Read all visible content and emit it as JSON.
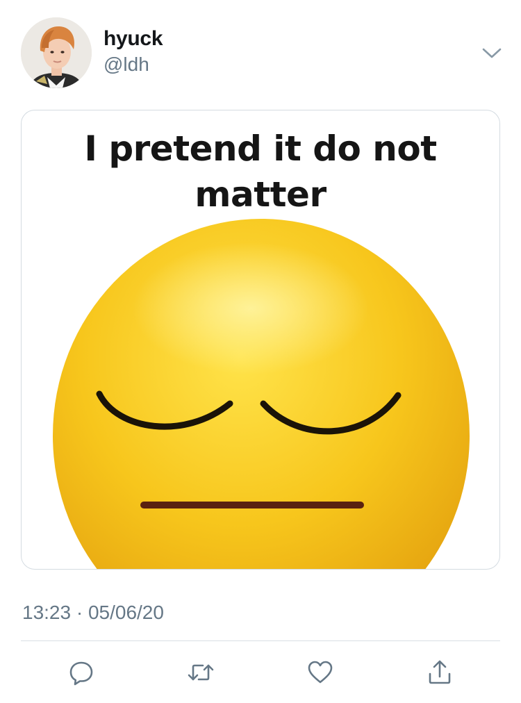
{
  "user": {
    "display_name": "hyuck",
    "handle": "@ldh",
    "avatar_icon": "profile-photo"
  },
  "tweet": {
    "media_caption": "I pretend it do not matter",
    "timestamp": "13:23 · 05/06/20"
  },
  "actions": [
    {
      "name": "reply",
      "icon": "speech-bubble-icon"
    },
    {
      "name": "retweet",
      "icon": "retweet-arrows-icon"
    },
    {
      "name": "like",
      "icon": "heart-icon"
    },
    {
      "name": "share",
      "icon": "upload-icon"
    }
  ],
  "colors": {
    "text_primary": "#14171a",
    "text_secondary": "#657786",
    "border": "#d4dbe1",
    "icon": "#657786",
    "emoji_yellow": "#f6c21a"
  }
}
